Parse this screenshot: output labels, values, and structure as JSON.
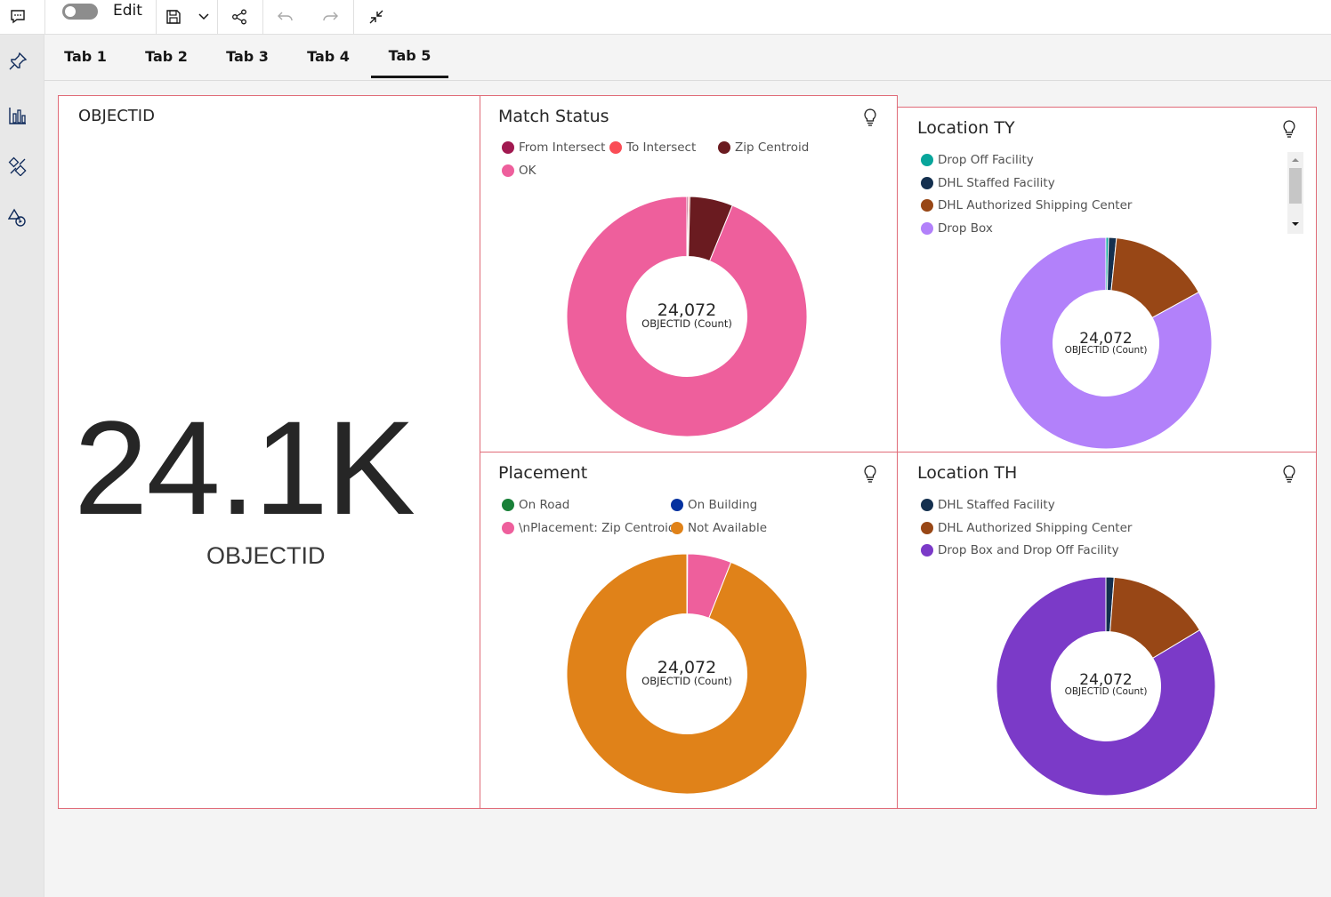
{
  "toolbar": {
    "edit_label": "Edit",
    "icons": [
      "comment-icon",
      "toggle-switch",
      "save-icon",
      "chevron-down-icon",
      "share-icon",
      "undo-icon",
      "redo-icon",
      "collapse-icon"
    ]
  },
  "sidebar": {
    "icons": [
      "pin-icon",
      "bar-chart-icon",
      "tools-icon",
      "shapes-icon"
    ]
  },
  "tabs": [
    {
      "label": "Tab 1"
    },
    {
      "label": "Tab 2"
    },
    {
      "label": "Tab 3"
    },
    {
      "label": "Tab 4"
    },
    {
      "label": "Tab 5",
      "active": true
    }
  ],
  "kpi": {
    "title": "OBJECTID",
    "value": "24.1K",
    "label": "OBJECTID"
  },
  "colors": {
    "panel_border": "#e06b78",
    "pink": "#ee5f9c",
    "dark_red": "#6a1b20",
    "magenta": "#a11950",
    "red": "#fa4d56",
    "teal": "#08a59b",
    "navy": "#14304f",
    "brown": "#984716",
    "lavender": "#b281fa",
    "purple": "#7b3ac8",
    "green": "#198038",
    "blue": "#0532a0",
    "orange": "#e08219"
  },
  "panels": {
    "match_status": {
      "title": "Match Status",
      "legend": [
        "From Intersect",
        "To Intersect",
        "Zip Centroid",
        "OK"
      ],
      "center_value": "24,072",
      "center_label": "OBJECTID (Count)"
    },
    "location_ty": {
      "title": "Location TY",
      "legend": [
        "Drop Off Facility",
        "DHL Staffed Facility",
        "DHL Authorized Shipping Center",
        "Drop Box"
      ],
      "center_value": "24,072",
      "center_label": "OBJECTID (Count)"
    },
    "placement": {
      "title": "Placement",
      "legend": [
        "On Road",
        "On Building",
        "\\nPlacement: Zip Centroid",
        "Not Available"
      ],
      "center_value": "24,072",
      "center_label": "OBJECTID (Count)"
    },
    "location_th": {
      "title": "Location TH",
      "legend": [
        "DHL Staffed Facility",
        "DHL Authorized Shipping Center",
        "Drop Box and Drop Off Facility"
      ],
      "center_value": "24,072",
      "center_label": "OBJECTID (Count)"
    }
  },
  "chart_data": [
    {
      "type": "pie",
      "id": "match_status",
      "categories": [
        "From Intersect",
        "To Intersect",
        "Zip Centroid",
        "OK"
      ],
      "values": [
        0.2,
        0.2,
        5.8,
        93.8
      ],
      "colors": [
        "#a11950",
        "#fa4d56",
        "#6a1b20",
        "#ee5f9c"
      ],
      "total": 24072
    },
    {
      "type": "pie",
      "id": "location_ty",
      "categories": [
        "Drop Off Facility",
        "DHL Staffed Facility",
        "DHL Authorized Shipping Center",
        "Drop Box"
      ],
      "values": [
        0.4,
        1.2,
        15.4,
        83.0
      ],
      "colors": [
        "#08a59b",
        "#14304f",
        "#984716",
        "#b281fa"
      ],
      "total": 24072
    },
    {
      "type": "pie",
      "id": "placement",
      "categories": [
        "On Road",
        "On Building",
        "\\nPlacement: Zip Centroid",
        "Not Available"
      ],
      "values": [
        0.05,
        0.05,
        5.9,
        94.0
      ],
      "colors": [
        "#198038",
        "#0532a0",
        "#ee5f9c",
        "#e08219"
      ],
      "total": 24072
    },
    {
      "type": "pie",
      "id": "location_th",
      "categories": [
        "DHL Staffed Facility",
        "DHL Authorized Shipping Center",
        "Drop Box and Drop Off Facility"
      ],
      "values": [
        1.2,
        15.2,
        83.6
      ],
      "colors": [
        "#14304f",
        "#984716",
        "#7b3ac8"
      ],
      "total": 24072
    }
  ]
}
